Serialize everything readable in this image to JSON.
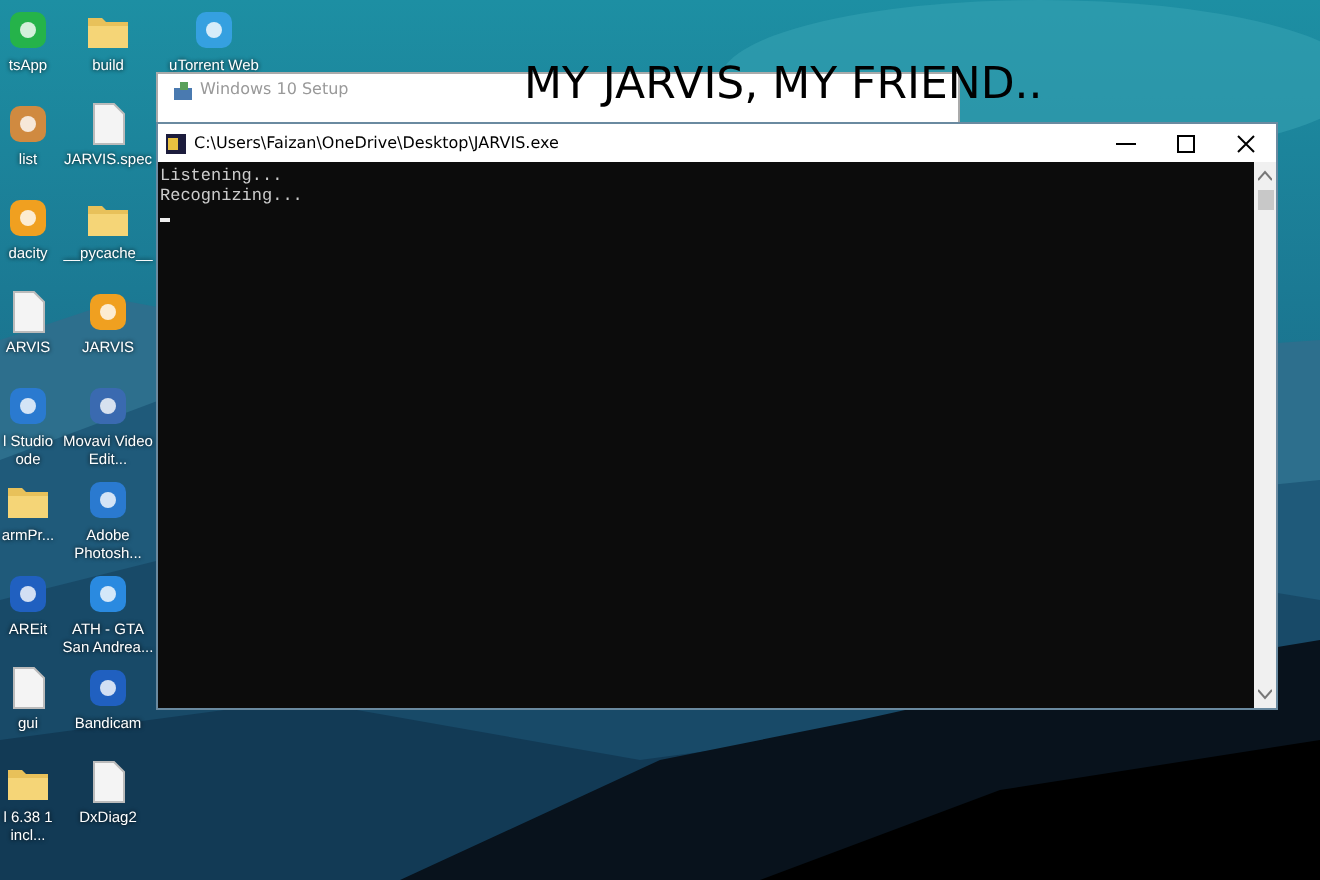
{
  "desktop_icons": [
    {
      "kind": "app",
      "label": "tsApp"
    },
    {
      "kind": "app",
      "label": "list"
    },
    {
      "kind": "app",
      "label": "dacity"
    },
    {
      "kind": "file",
      "label": "ARVIS"
    },
    {
      "kind": "app",
      "label": "l Studio ode"
    },
    {
      "kind": "folder",
      "label": "armPr..."
    },
    {
      "kind": "app",
      "label": "AREit"
    },
    {
      "kind": "file",
      "label": "gui"
    },
    {
      "kind": "folder",
      "label": "l 6.38 1 incl..."
    },
    {
      "kind": "folder",
      "label": "build"
    },
    {
      "kind": "file",
      "label": "JARVIS.spec"
    },
    {
      "kind": "folder",
      "label": "__pycache__"
    },
    {
      "kind": "app",
      "label": "JARVIS"
    },
    {
      "kind": "app",
      "label": "Movavi Video Edit..."
    },
    {
      "kind": "app",
      "label": "Adobe Photosh..."
    },
    {
      "kind": "app",
      "label": "ATH - GTA San Andrea..."
    },
    {
      "kind": "app",
      "label": "Bandicam"
    },
    {
      "kind": "file",
      "label": "DxDiag2"
    },
    {
      "kind": "app",
      "label": "uTorrent Web"
    }
  ],
  "background_window": {
    "title": "Windows 10 Setup"
  },
  "caption": "MY JARVIS, MY FRIEND..",
  "console": {
    "title": "C:\\Users\\Faizan\\OneDrive\\Desktop\\JARVIS.exe",
    "lines": [
      "Listening...",
      "Recognizing..."
    ]
  }
}
